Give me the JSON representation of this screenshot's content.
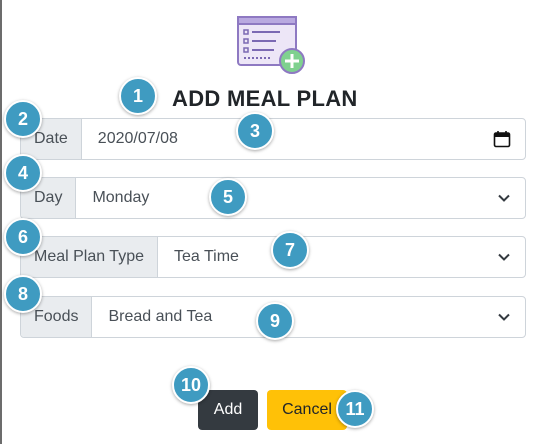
{
  "header": {
    "title": "ADD MEAL PLAN",
    "logo_icon": "meal-plan-add-icon"
  },
  "form": {
    "date": {
      "label": "Date",
      "value": "2020/07/08",
      "icon": "calendar-icon"
    },
    "day": {
      "label": "Day",
      "value": "Monday"
    },
    "meal_type": {
      "label": "Meal Plan Type",
      "value": "Tea Time"
    },
    "foods": {
      "label": "Foods",
      "value": "Bread and Tea"
    }
  },
  "actions": {
    "add_label": "Add",
    "cancel_label": "Cancel"
  },
  "badges": [
    "1",
    "2",
    "3",
    "4",
    "5",
    "6",
    "7",
    "8",
    "9",
    "10",
    "11"
  ],
  "colors": {
    "badge": "#3f9bc1",
    "add_button": "#343a40",
    "cancel_button": "#ffc107"
  }
}
